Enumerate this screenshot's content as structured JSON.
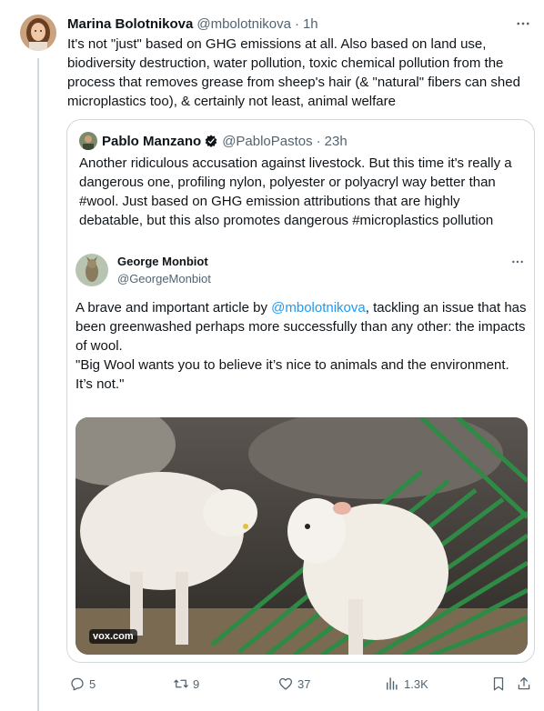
{
  "tweet": {
    "author_name": "Marina Bolotnikova",
    "handle": "@mbolotnikova",
    "separator": "·",
    "time": "1h",
    "text": "It's not \"just\" based on GHG emissions at all. Also based on land use, biodiversity destruction, water pollution, toxic chemical pollution from the process that removes grease from sheep's hair (& \"natural\" fibers can shed microplastics too), & certainly not least, animal welfare",
    "more_icon": "ellipsis-icon"
  },
  "quote": {
    "author_name": "Pablo Manzano",
    "verified_icon": "verified-badge-icon",
    "handle": "@PabloPastos",
    "separator": "·",
    "time": "23h",
    "text": "Another ridiculous accusation against livestock. But this time it's really a dangerous one, profiling nylon, polyester or polyacryl way better than #wool. Just based on GHG emission attributions that are highly debatable,  but this also promotes dangerous #microplastics pollution",
    "inner": {
      "author_name": "George Monbiot",
      "handle": "@GeorgeMonbiot",
      "text_before": "A brave and important article by ",
      "mention": "@mbolotnikova",
      "text_after": ", tackling an issue that has been greenwashed perhaps more successfully than any other: the impacts of wool.",
      "text_quote": "\"Big Wool wants you to believe it’s nice to animals and the environment. It’s not.\"",
      "media_source": "vox.com"
    }
  },
  "actions": {
    "reply_count": "5",
    "retweet_count": "9",
    "like_count": "37",
    "views_count": "1.3K"
  },
  "colors": {
    "text_primary": "#0f1419",
    "text_secondary": "#536471",
    "accent": "#1d9bf0",
    "border": "#cfd9de"
  }
}
